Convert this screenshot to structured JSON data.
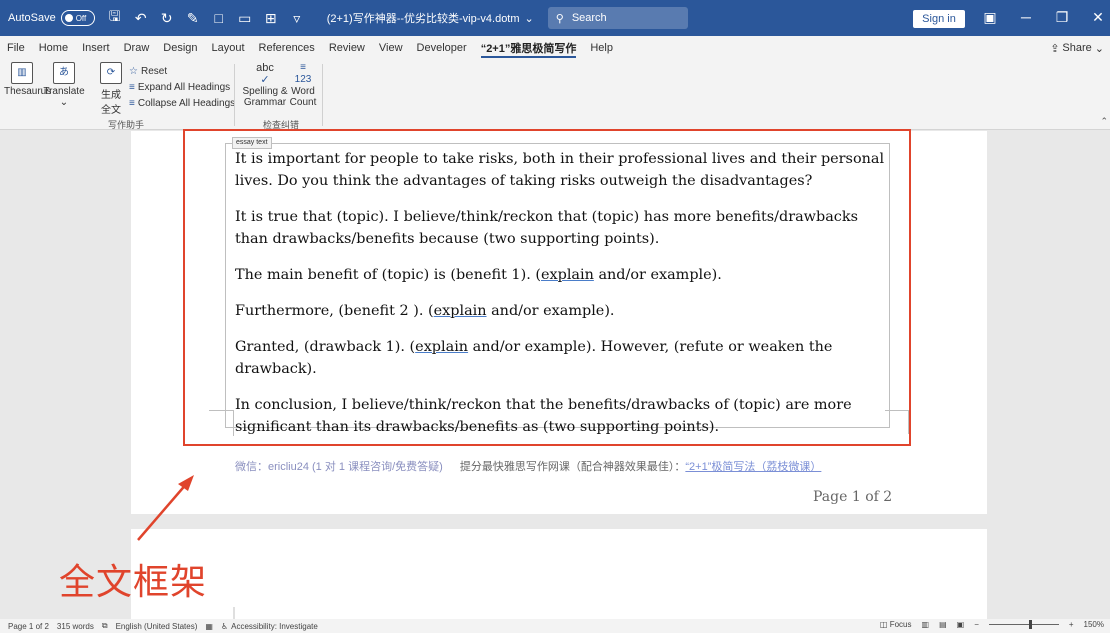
{
  "titlebar": {
    "autosave_label": "AutoSave",
    "autosave_state": "Off",
    "doc_title": "(2+1)写作神器--优劣比较类-vip-v4.dotm",
    "search_placeholder": "Search",
    "signin_label": "Sign in"
  },
  "menu": {
    "tabs": [
      "File",
      "Home",
      "Insert",
      "Draw",
      "Design",
      "Layout",
      "References",
      "Review",
      "View",
      "Developer",
      "“2+1”雅思极简写作",
      "Help"
    ],
    "active_index": 10,
    "share_label": "Share"
  },
  "ribbon": {
    "thesaurus": "Thesaurus",
    "translate": "Translate",
    "generate_line1": "生成",
    "generate_line2": "全文",
    "reset": "Reset",
    "expand_all": "Expand All Headings",
    "collapse_all": "Collapse All Headings",
    "group1_label": "写作助手",
    "spelling_line1": "Spelling &",
    "spelling_line2": "Grammar",
    "wordcount_line1": "Word",
    "wordcount_line2": "Count",
    "group2_label": "检查纠错"
  },
  "document": {
    "content_control_tag": "essay text",
    "paragraphs": {
      "p1": "It is important for people to take risks, both in their professional lives and their personal lives. Do you think the advantages of taking risks outweigh the disadvantages?",
      "p2": "It is true that (topic). I believe/think/reckon that (topic) has more benefits/drawbacks than drawbacks/benefits because (two supporting points).",
      "p3_pre": "The main benefit of (topic) is (benefit 1). (",
      "p3_ul": "explain",
      "p3_post": " and/or example).",
      "p4_pre": "Furthermore, (benefit 2 ). (",
      "p4_ul": "explain",
      "p4_post": " and/or example).",
      "p5_pre": "Granted, (drawback 1). (",
      "p5_ul": "explain",
      "p5_post": " and/or example). However, (refute or weaken the drawback).",
      "p6": "In conclusion, I believe/think/reckon that the benefits/drawbacks of (topic) are more significant than its drawbacks/benefits as (two supporting points)."
    },
    "footer_wechat": "微信：ericliu24 (1 对 1 课程咨询/免费答疑)",
    "footer_course": "提分最快雅思写作网课（配合神器效果最佳）：",
    "footer_link": "“2+1”极简写法（荔枝微课）",
    "page_number": "Page 1 of 2"
  },
  "annotation": {
    "label": "全文框架",
    "color": "#e0442c"
  },
  "statusbar": {
    "page": "Page 1 of 2",
    "words": "315 words",
    "language": "English (United States)",
    "accessibility": "Accessibility: Investigate",
    "focus": "Focus",
    "zoom": "150%"
  },
  "colors": {
    "titlebar": "#2b579a",
    "accent": "#2b579a",
    "annotation_red": "#e0442c"
  }
}
